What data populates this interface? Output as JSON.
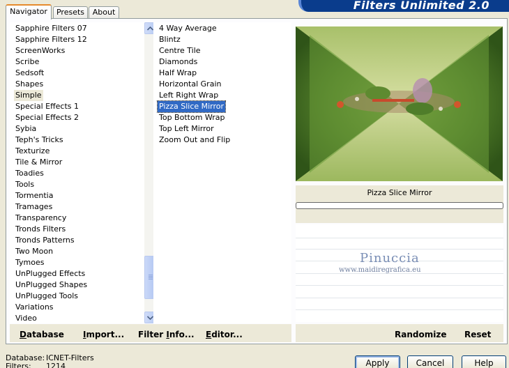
{
  "window_title": "Filters Unlimited 2.0",
  "tabs": [
    "Navigator",
    "Presets",
    "About"
  ],
  "categories": [
    "Sapphire Filters 07",
    "Sapphire Filters 12",
    "ScreenWorks",
    "Scribe",
    "Sedsoft",
    "Shapes",
    "Simple",
    "Special Effects 1",
    "Special Effects 2",
    "Sybia",
    "Teph's Tricks",
    "Texturize",
    "Tile & Mirror",
    "Toadies",
    "Tools",
    "Tormentia",
    "Tramages",
    "Transparency",
    "Tronds Filters",
    "Tronds Patterns",
    "Two Moon",
    "Tymoes",
    "UnPlugged Effects",
    "UnPlugged Shapes",
    "UnPlugged Tools",
    "Variations",
    "Video"
  ],
  "selected_category": "Simple",
  "filters": [
    "4 Way Average",
    "Blintz",
    "Centre Tile",
    "Diamonds",
    "Half Wrap",
    "Horizontal Grain",
    "Left Right Wrap",
    "Pizza Slice Mirror",
    "Top Bottom Wrap",
    "Top Left Mirror",
    "Zoom Out and Flip"
  ],
  "selected_filter": "Pizza Slice Mirror",
  "preview": {
    "filter_name": "Pizza Slice Mirror",
    "progress": 0,
    "watermark_title": "Pinuccia",
    "watermark_url": "www.maidiregrafica.eu"
  },
  "commands": {
    "database": {
      "pre": "",
      "u": "D",
      "post": "atabase"
    },
    "import": {
      "pre": "",
      "u": "I",
      "post": "mport..."
    },
    "filter_info": {
      "pre": "Filter ",
      "u": "I",
      "post": "nfo..."
    },
    "editor": {
      "pre": "",
      "u": "E",
      "post": "ditor..."
    },
    "randomize": "Randomize",
    "reset": "Reset"
  },
  "footer": {
    "database_label": "Database:",
    "database_value": "ICNET-Filters",
    "filters_label": "Filters:",
    "filters_value": "1214"
  },
  "buttons": {
    "apply": "Apply",
    "cancel": "Cancel",
    "help": "Help"
  },
  "colors": {
    "selection": "#316ac5",
    "banner": "#0a3c8c",
    "dialog_bg": "#ece9d8"
  }
}
